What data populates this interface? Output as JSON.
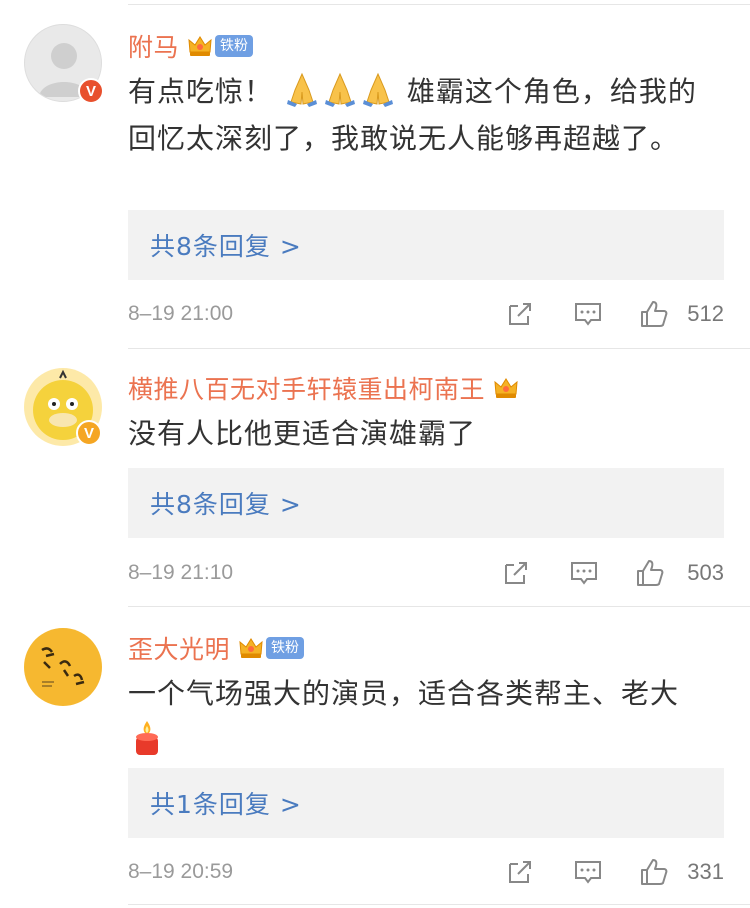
{
  "comments": [
    {
      "user": "附马",
      "has_fan_badge": true,
      "fan_badge": "铁粉",
      "verify_color": "#e8502d",
      "text_before": "有点吃惊！",
      "emoji": "pray-emoji x3",
      "text_after": "雄霸这个角色，给我的回忆太深刻了，我敢说无人能够再超越了。",
      "reply_label": "共8条回复 >",
      "time": "8–19 21:00",
      "likes": "512"
    },
    {
      "user": "横推八百无对手轩辕重出柯南王",
      "has_fan_badge": false,
      "verify_color": "#f5a623",
      "text": "没有人比他更适合演雄霸了",
      "reply_label": "共8条回复 >",
      "time": "8–19 21:10",
      "likes": "503"
    },
    {
      "user": "歪大光明",
      "has_fan_badge": true,
      "fan_badge": "铁粉",
      "text": "一个气场强大的演员，适合各类帮主、老大",
      "emoji": "candle-emoji",
      "reply_label": "共1条回复 >",
      "time": "8–19 20:59",
      "likes": "331"
    }
  ],
  "colors": {
    "username": "#eb7350",
    "link": "#4a7bbf",
    "reply_bg": "#f2f2f2",
    "fan_badge": "#6f9fe3"
  },
  "icons": [
    "crown-icon",
    "share-icon",
    "comment-icon",
    "like-icon",
    "verified-icon"
  ]
}
